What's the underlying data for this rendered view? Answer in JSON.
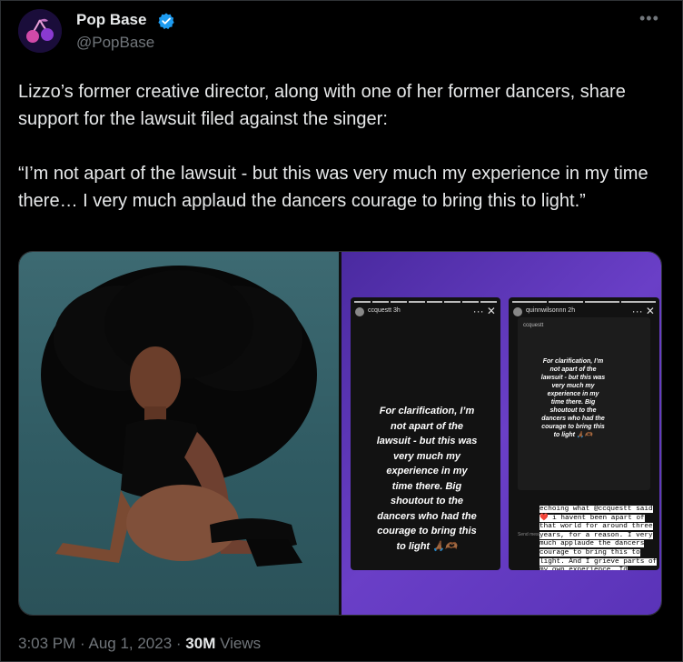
{
  "author": {
    "name": "Pop Base",
    "handle": "@PopBase"
  },
  "tweet": {
    "text": "Lizzo’s former creative director, along with one of her former dancers, share support for the lawsuit filed against the singer:\n\n“I’m not apart of the lawsuit - but this was very much my experience in my time there… I very much applaud the dancers courage to bring this to light.”"
  },
  "media": {
    "story1": {
      "user": "ccquestt  3h",
      "text": "For clarification, I’m\nnot apart of the\nlawsuit - but this was\nvery much my\nexperience in my\ntime there. Big\nshoutout to the\ndancers who had the\ncourage to bring this\nto light 🙏🏾🫶🏾"
    },
    "story2": {
      "user": "quinnwilsonnn  2h",
      "sub_user": "ccquestt",
      "text": "For clarification, I’m\nnot apart of the\nlawsuit - but this was\nvery much my\nexperience in my\ntime there. Big\nshoutout to the\ndancers who had the\ncourage to bring this\nto light 🙏🏾🫶🏾",
      "send_message": "Send message",
      "mono_text": "echoing what @ccquestt said ❤️ i havent been apart of that world for around three years, for a reason. I very much applaude the dancers courage to bring this to light. And I grieve parts of my own experience. Id appreciate space to understand my feelings."
    }
  },
  "footer": {
    "time": "3:03 PM",
    "date": "Aug 1, 2023",
    "views_count": "30M",
    "views_label": "Views"
  },
  "colors": {
    "verified": "#1d9bf0",
    "muted": "#71767b"
  },
  "icons": [
    "cherry-logo-icon",
    "verified-badge-icon",
    "more-options-icon",
    "close-icon"
  ]
}
